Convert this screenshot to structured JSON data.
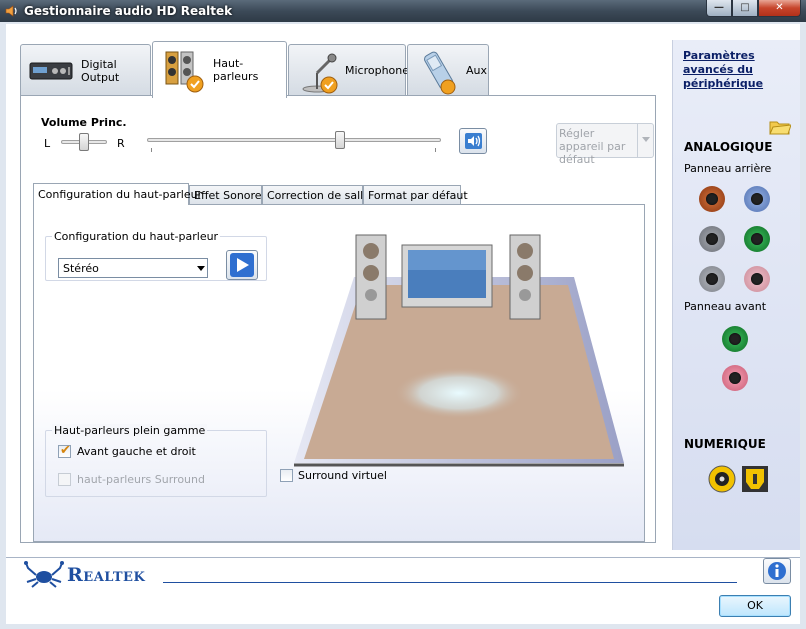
{
  "window": {
    "title": "Gestionnaire audio HD Realtek",
    "controls": {
      "minimize": "—",
      "maximize": "□",
      "close": "✕"
    }
  },
  "tabs": [
    {
      "label": "Digital Output",
      "icon": "digital-output-device-icon"
    },
    {
      "label": "Haut-parleurs",
      "icon": "speakers-icon",
      "active": true
    },
    {
      "label": "Microphone",
      "icon": "microphone-icon"
    },
    {
      "label": "Aux",
      "icon": "aux-phone-icon"
    }
  ],
  "volume": {
    "label": "Volume Princ.",
    "balance_left": "L",
    "balance_right": "R",
    "balance_level": 0.5,
    "master_level": 0.65
  },
  "set_default": {
    "label": "Régler appareil par défaut"
  },
  "subtabs": [
    {
      "label": "Configuration du haut-parleur",
      "active": true
    },
    {
      "label": "Effet Sonore"
    },
    {
      "label": "Correction de salle"
    },
    {
      "label": "Format par défaut"
    }
  ],
  "config_group": {
    "title": "Configuration du haut-parleur",
    "selected": "Stéréo"
  },
  "fullrange_group": {
    "title": "Haut-parleurs plein gamme",
    "front": {
      "label": "Avant gauche et droit",
      "checked": true
    },
    "surround": {
      "label": "haut-parleurs Surround",
      "checked": false,
      "disabled": true
    }
  },
  "virtual_surround": {
    "label": "Surround virtuel",
    "checked": false
  },
  "right_panel": {
    "advanced_link": "Paramètres avancés du périphérique",
    "analog_title": "ANALOGIQUE",
    "rear_panel": "Panneau arrière",
    "front_panel": "Panneau avant",
    "digital_title": "NUMERIQUE"
  },
  "brand": "Realtek",
  "ok_label": "OK",
  "colors": {
    "jack_orange": "#c8561e",
    "jack_blue": "#6d8fd0",
    "jack_grey": "#8a8e96",
    "jack_green": "#1f9a38",
    "jack_pink": "#e07d92",
    "brand_blue": "#1f4fa0"
  }
}
